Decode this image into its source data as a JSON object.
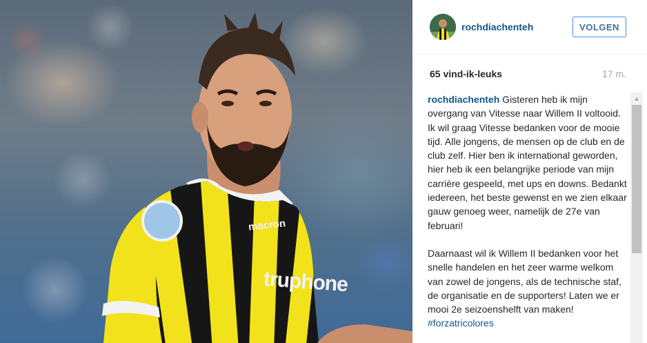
{
  "post": {
    "username": "rochdiachenteh",
    "follow_label": "VOLGEN",
    "likes": "65 vind-ik-leuks",
    "time_ago": "17 m."
  },
  "caption": {
    "author": "rochdiachenteh",
    "paragraph1_intro": " Gisteren heb ik mijn overgang van Vitesse naar Willem II voltooid.",
    "paragraph1_body": "Ik wil graag Vitesse bedanken voor de mooie tijd. Alle jongens, de mensen op de club en de club zelf. Hier ben ik international geworden, hier heb ik een belangrijke periode van mijn carrière gespeeld, met ups en downs. Bedankt iedereen, het beste gewenst en we zien elkaar gauw genoeg weer, namelijk de 27e van februari!",
    "paragraph2": "Daarnaast wil ik Willem II bedanken voor het snelle handelen en het zeer warme welkom van zowel de jongens, als de technische staf, de organisatie en de supporters! Laten we er mooi 2e seizoenshelft van maken!",
    "hashtag": "#forzatricolores"
  },
  "photo": {
    "shirt_sponsor": "truphone",
    "shirt_brand": "macron"
  },
  "colors": {
    "link_blue": "#125688",
    "button_border": "#4090db",
    "shirt_yellow": "#f2e21b",
    "shirt_black": "#161616"
  }
}
